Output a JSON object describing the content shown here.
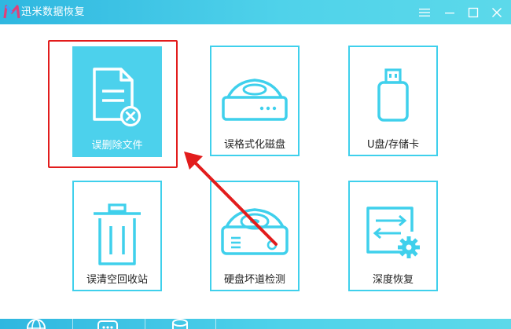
{
  "app": {
    "title": "迅米数据恢复"
  },
  "window_controls": [
    {
      "name": "menu-icon"
    },
    {
      "name": "minimize-icon"
    },
    {
      "name": "maximize-icon"
    },
    {
      "name": "close-icon"
    }
  ],
  "cards": [
    {
      "label": "误删除文件",
      "icon": "document-delete-icon",
      "selected": true
    },
    {
      "label": "误格式化磁盘",
      "icon": "hard-disk-icon",
      "selected": false
    },
    {
      "label": "U盘/存储卡",
      "icon": "usb-drive-icon",
      "selected": false
    },
    {
      "label": "误清空回收站",
      "icon": "recycle-bin-icon",
      "selected": false
    },
    {
      "label": "硬盘坏道检测",
      "icon": "disk-scan-icon",
      "selected": false
    },
    {
      "label": "深度恢复",
      "icon": "deep-recovery-icon",
      "selected": false
    }
  ],
  "annotation": {
    "color": "#e21c1c",
    "arrow": "red-arrow-pointing-to-selected-card"
  },
  "colors": {
    "accent": "#4cd1ec",
    "titlebar": "#2fb7e0",
    "highlight": "#e21c1c"
  },
  "bottom_bar": {
    "icons": [
      "globe-icon",
      "chat-icon",
      "database-icon"
    ]
  }
}
